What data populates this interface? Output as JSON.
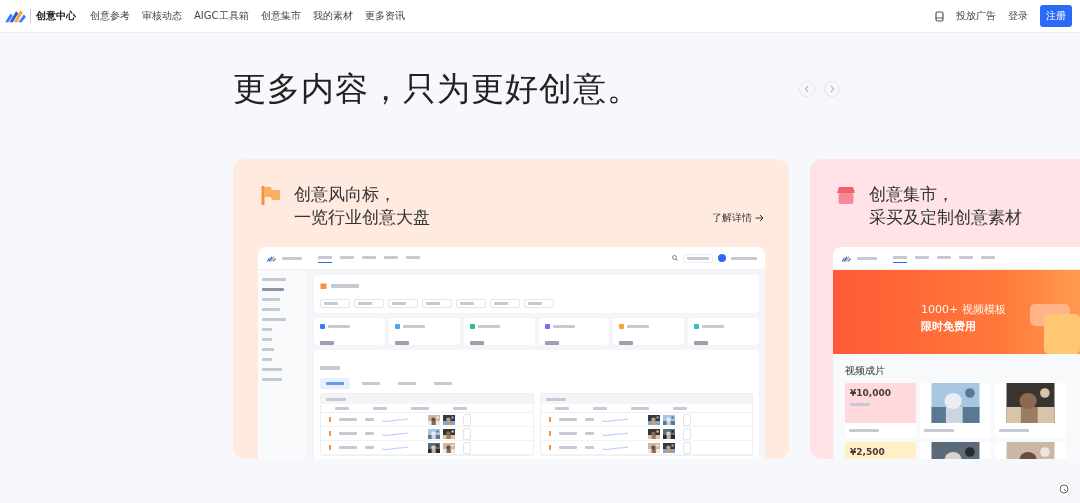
{
  "header": {
    "logo": "创意中心",
    "nav": [
      {
        "label": "创意参考"
      },
      {
        "label": "审核动态"
      },
      {
        "label": "AIGC工具箱"
      },
      {
        "label": "创意集市"
      },
      {
        "label": "我的素材"
      },
      {
        "label": "更多资讯"
      }
    ],
    "ad_link": "投放广告",
    "login": "登录",
    "register": "注册"
  },
  "hero": {
    "title": "更多内容，只为更好创意。"
  },
  "cards": [
    {
      "kind": "trend",
      "color": "#ffeadf",
      "title_lines": [
        "创意风向标，",
        "一览行业创意大盘"
      ],
      "link": "了解详情",
      "preview": {
        "nav": [
          {
            "selected": true
          },
          {
            "selected": false
          },
          {
            "selected": false
          },
          {
            "selected": false
          },
          {
            "selected": false
          }
        ],
        "metrics": [
          {
            "color": "#3b7cf6"
          },
          {
            "color": "#4aa8f0"
          },
          {
            "color": "#2fc27a"
          },
          {
            "color": "#8a63f2"
          },
          {
            "color": "#f5a33b"
          },
          {
            "color": "#2bc4b4"
          }
        ],
        "tabs": [
          {
            "selected": true
          },
          {
            "selected": false
          },
          {
            "selected": false
          },
          {
            "selected": false
          }
        ]
      }
    },
    {
      "kind": "market",
      "color": "#ffe3e6",
      "title_lines": [
        "创意集市，",
        "采买及定制创意素材"
      ],
      "preview": {
        "nav": [
          {
            "selected": true
          },
          {
            "selected": false
          },
          {
            "selected": false
          },
          {
            "selected": false
          },
          {
            "selected": false
          }
        ],
        "banner_lines": [
          "1000+ 视频模板",
          "限时免费用"
        ],
        "section_title": "视频成片",
        "tiles": [
          {
            "kind": "price",
            "price": "¥10,000",
            "color": "#ffd9dc"
          },
          {
            "kind": "picture"
          },
          {
            "kind": "picture"
          },
          {
            "kind": "price",
            "price": "¥2,500",
            "color": "#fff0c8"
          },
          {
            "kind": "picture"
          },
          {
            "kind": "picture"
          }
        ]
      }
    }
  ]
}
